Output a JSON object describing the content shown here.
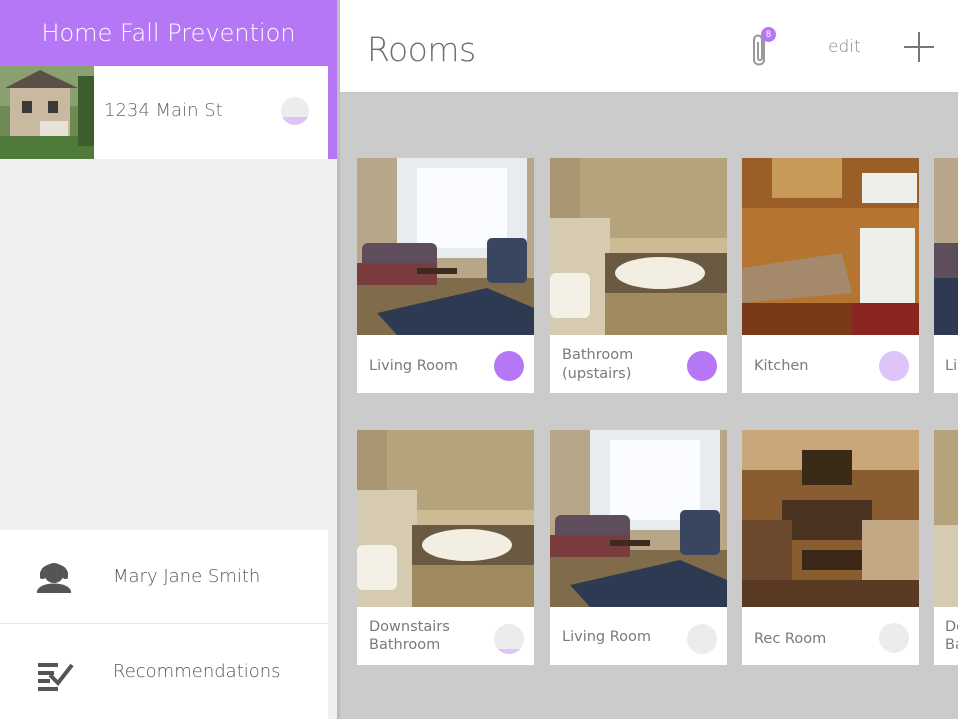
{
  "sidebar": {
    "app_title": "Home Fall Prevention",
    "home": {
      "address": "1234 Main St",
      "progress": 0.3
    },
    "user": {
      "name": "Mary Jane Smith"
    },
    "recommendations": {
      "label": "Recommendations"
    }
  },
  "header": {
    "title": "Rooms",
    "attachments_count": "8",
    "edit_label": "edit"
  },
  "colors": {
    "accent": "#b577f5",
    "accent_light": "#dcc4f7",
    "empty_status": "#ececec"
  },
  "rooms": [
    {
      "name": "Living Room",
      "status": "complete"
    },
    {
      "name": "Bathroom (upstairs)",
      "line1": "Bathroom",
      "line2": "(upstairs)",
      "status": "complete"
    },
    {
      "name": "Kitchen",
      "status": "partial"
    },
    {
      "name": "Liv",
      "status": "unknown"
    },
    {
      "name": "Downstairs Bathroom",
      "line1": "Downstairs",
      "line2": "Bathroom",
      "status": "started"
    },
    {
      "name": "Living Room",
      "status": "empty"
    },
    {
      "name": "Rec Room",
      "status": "empty"
    },
    {
      "name": "Do Ba",
      "line1": "Do",
      "line2": "Ba",
      "status": "unknown"
    }
  ]
}
